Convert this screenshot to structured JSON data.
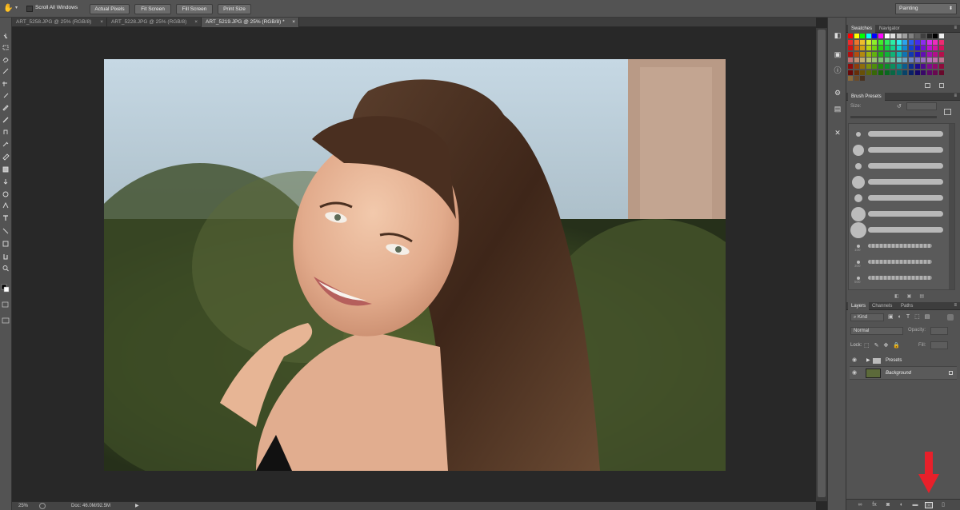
{
  "options_bar": {
    "scroll_all_windows": "Scroll All Windows",
    "actual_pixels": "Actual Pixels",
    "fit_screen": "Fit Screen",
    "fill_screen": "Fill Screen",
    "print_size": "Print Size",
    "workspace": "Painting"
  },
  "tabs": [
    {
      "label": "ART_5258.JPG @ 25% (RGB/8)"
    },
    {
      "label": "ART_5228.JPG @ 25% (RGB/8)"
    },
    {
      "label": "ART_5219.JPG @ 25% (RGB/8) *"
    }
  ],
  "tab_close": "×",
  "status": {
    "zoom": "25%",
    "doc": "Doc: 46.0M/92.5M"
  },
  "panels": {
    "swatches_tab": "Swatches",
    "navigator_tab": "Navigator",
    "brush_presets_tab": "Brush Presets",
    "size_label": "Size:",
    "layers_tab": "Layers",
    "channels_tab": "Channels",
    "paths_tab": "Paths",
    "kind": "Kind",
    "blend_mode": "Normal",
    "opacity_label": "Opacity:",
    "lock_label": "Lock:",
    "fill_label": "Fill:",
    "brush_sizes": [
      "",
      "",
      "",
      "",
      "",
      "",
      "",
      "100",
      "300",
      "500"
    ],
    "layers": [
      {
        "name": "Presets"
      },
      {
        "name": "Background"
      }
    ]
  },
  "colors": {
    "accent_arrow": "#e8202a",
    "panel_bg": "#535353",
    "canvas_bg": "#282828"
  }
}
